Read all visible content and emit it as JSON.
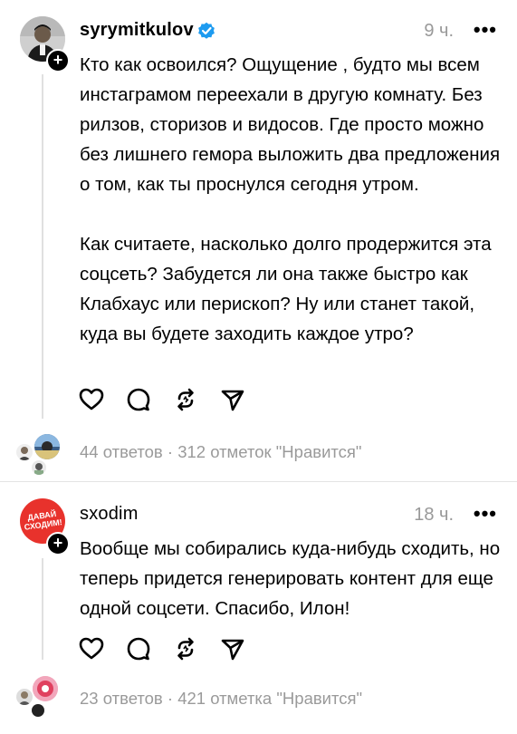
{
  "posts": [
    {
      "username": "syrymitkulov",
      "verified": true,
      "time": "9 ч.",
      "more": "•••",
      "paragraphs": [
        "Кто как освоился? Ощущение , будто мы всем инстаграмом переехали в другую комнату. Без рилзов, сторизов и видосов. Где просто можно без лишнего гемора выложить два предложения о том, как ты проснулся сегодня утром.",
        "Как считаете, насколько долго продержится эта соцсеть? Забудется ли она также быстро как Клабхаус или перископ? Ну или станет такой, куда вы будете заходить каждое утро?"
      ],
      "stats": "44 ответов · 312 отметок \"Нравится\"",
      "plus": "+"
    },
    {
      "username": "sxodim",
      "verified": false,
      "time": "18 ч.",
      "more": "•••",
      "avatar_text": [
        "ДАВАЙ",
        "СХОДИМ!"
      ],
      "paragraphs": [
        "Вообще мы собирались куда-нибудь сходить, но теперь придется генерировать контент для еще одной соцсети. Спасибо, Илон!"
      ],
      "stats": "23 ответов · 421 отметка \"Нравится\"",
      "plus": "+"
    }
  ],
  "colors": {
    "verified": "#1d9bf0",
    "sxodim_avatar": "#e8322c",
    "muted": "#9a9a9a"
  }
}
